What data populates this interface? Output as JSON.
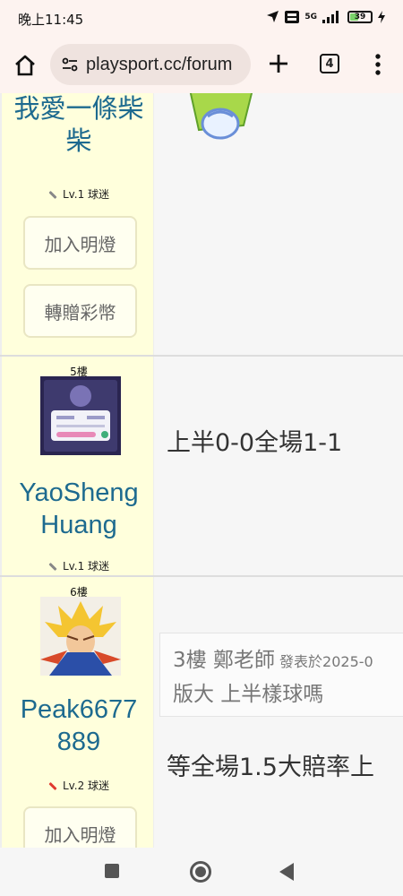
{
  "status": {
    "time": "晚上11:45",
    "network": "5G",
    "battery": "39",
    "battery_level": 0.39
  },
  "browser": {
    "url": "playsport.cc/forum",
    "tab_count": "4"
  },
  "posts": [
    {
      "username": "我愛一條柴柴",
      "level": "Lv.1 球迷",
      "buttons": [
        "加入明燈",
        "轉贈彩幣"
      ]
    },
    {
      "floor": "5樓",
      "username": "YaoSheng Huang",
      "level": "Lv.1 球迷",
      "content": "上半0-0全場1-1"
    },
    {
      "floor": "6樓",
      "username": "Peak6677 889",
      "level": "Lv.2 球迷",
      "quote": {
        "floor": "3樓 鄭老師",
        "meta": "發表於2025-0",
        "text": "版大 上半樣球嗎"
      },
      "content": "等全場1.5大賠率上",
      "buttons": [
        "加入明燈"
      ]
    }
  ],
  "colors": {
    "sidebar_bg": "#ffffdc",
    "username": "#1d6a8f",
    "lv1_pen": "#888888",
    "lv2_pen": "#e03a2f"
  }
}
